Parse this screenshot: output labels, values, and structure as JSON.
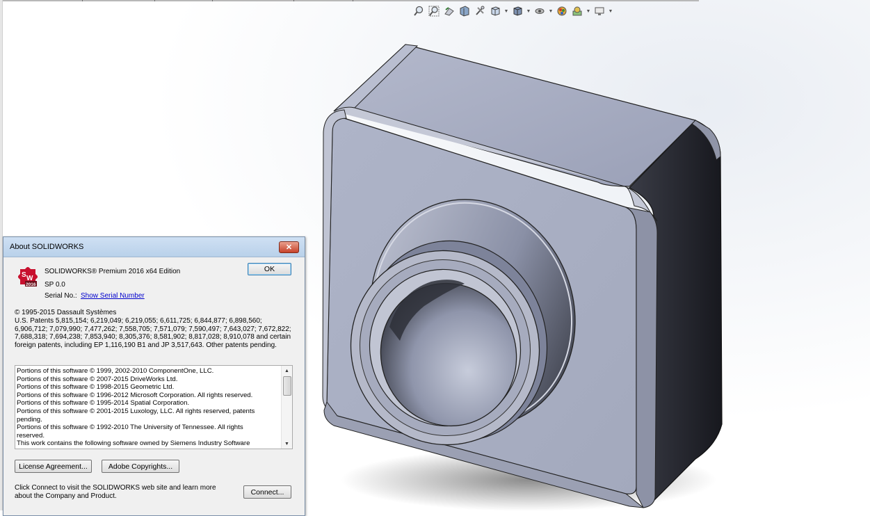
{
  "window": {
    "title": "About SOLIDWORKS",
    "close_glyph": "✕"
  },
  "hud_toolbar": {
    "icons": [
      "zoom-to-fit-icon",
      "zoom-to-area-icon",
      "previous-view-icon",
      "section-view-icon",
      "dynamic-annotation-icon",
      "view-orientation-icon",
      "display-style-icon",
      "hide-show-items-icon",
      "edit-appearance-icon",
      "apply-scene-icon",
      "view-settings-icon"
    ]
  },
  "logo": {
    "top": "S",
    "mid": "W",
    "year": "2016"
  },
  "about": {
    "product": "SOLIDWORKS® Premium 2016 x64 Edition",
    "sp": "SP 0.0",
    "serial_label": "Serial No.:",
    "serial_link": "Show Serial Number",
    "copyright": "© 1995-2015 Dassault Systèmes",
    "patents": "U.S. Patents 5,815,154; 6,219,049; 6,219,055; 6,611,725; 6,844,877; 6,898,560; 6,906,712; 7,079,990; 7,477,262; 7,558,705; 7,571,079; 7,590,497; 7,643,027; 7,672,822; 7,688,318; 7,694,238; 7,853,940; 8,305,376; 8,581,902; 8,817,028; 8,910,078 and certain foreign patents, including EP 1,116,190 B1 and JP 3,517,643. Other patents pending.",
    "notices": [
      "Portions of this software © 1999, 2002-2010 ComponentOne, LLC.",
      "Portions of this software © 2007-2015 DriveWorks Ltd.",
      "Portions of this software © 1998-2015 Geometric Ltd.",
      "Portions of this software © 1996-2012 Microsoft Corporation. All rights reserved.",
      "Portions of this software © 1995-2014 Spatial Corporation.",
      "Portions of this software © 2001-2015 Luxology, LLC. All rights reserved, patents",
      "pending.",
      "Portions of this software © 1992-2010 The University of Tennessee. All rights",
      "reserved.",
      "This work contains the following software owned by Siemens Industry Software"
    ],
    "ok_label": "OK",
    "license_label": "License Agreement...",
    "adobe_label": "Adobe Copyrights...",
    "connect_text": "Click Connect to visit the SOLIDWORKS web site and learn more about the Company and Product.",
    "connect_label": "Connect..."
  },
  "colors": {
    "logo_red": "#c8102e",
    "link": "#0000cc",
    "model_face": "#a9afc4",
    "model_dark": "#1f2027"
  }
}
